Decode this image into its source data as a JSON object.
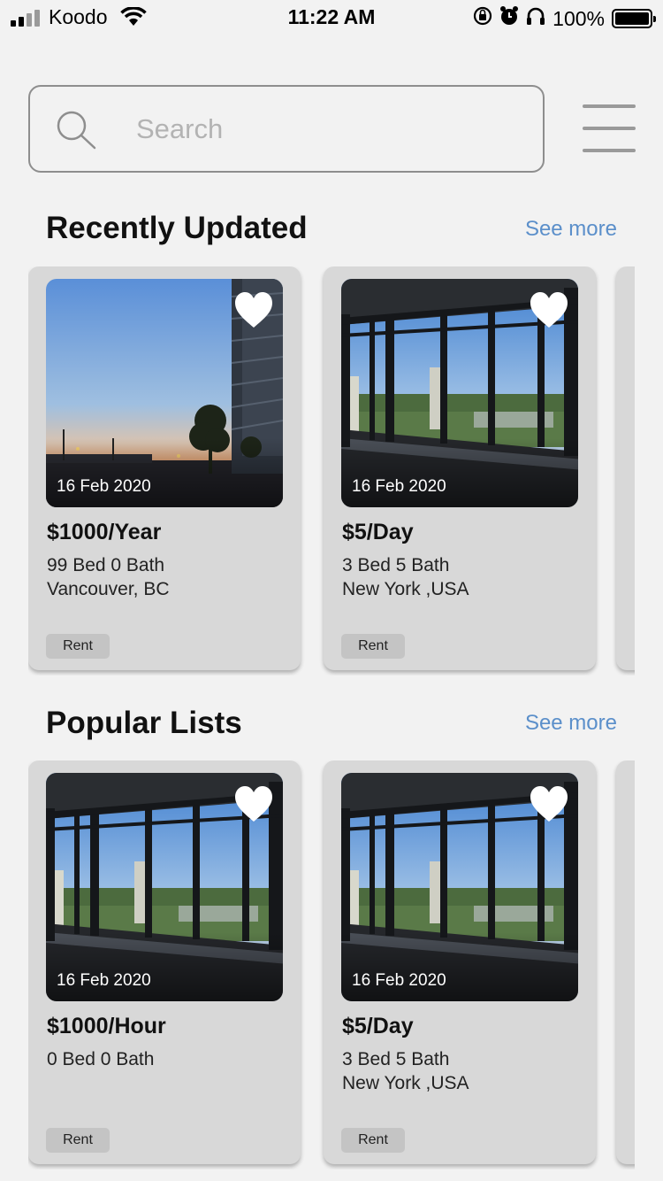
{
  "status_bar": {
    "carrier": "Koodo",
    "time": "11:22 AM",
    "battery": "100%",
    "icons": [
      "signal-icon",
      "wifi-icon",
      "rotation-lock-icon",
      "alarm-icon",
      "headphones-icon",
      "battery-icon"
    ]
  },
  "search": {
    "placeholder": "Search",
    "icon": "search-icon"
  },
  "menu": {
    "icon": "hamburger-menu-icon"
  },
  "colors": {
    "background": "#f2f2f2",
    "card": "#d8d8d8",
    "link": "#5b8fca",
    "tag": "#c4c4c4"
  },
  "sections": [
    {
      "title": "Recently Updated",
      "see_more": "See more",
      "cards": [
        {
          "date": "16 Feb 2020",
          "price": "$1000/Year",
          "beds": "99 Bed 0 Bath",
          "location": "Vancouver, BC",
          "tag": "Rent",
          "image": "sunset-street-photo"
        },
        {
          "date": "16 Feb 2020",
          "price": "$5/Day",
          "beds": "3 Bed 5 Bath",
          "location": "New York ,USA",
          "tag": "Rent",
          "image": "window-view-photo"
        }
      ]
    },
    {
      "title": "Popular Lists",
      "see_more": "See more",
      "cards": [
        {
          "date": "16 Feb 2020",
          "price": "$1000/Hour",
          "beds": "0 Bed 0 Bath",
          "location": "",
          "tag": "Rent",
          "image": "window-view-photo"
        },
        {
          "date": "16 Feb 2020",
          "price": "$5/Day",
          "beds": "3 Bed 5 Bath",
          "location": "New York ,USA",
          "tag": "Rent",
          "image": "window-view-photo"
        }
      ]
    }
  ]
}
